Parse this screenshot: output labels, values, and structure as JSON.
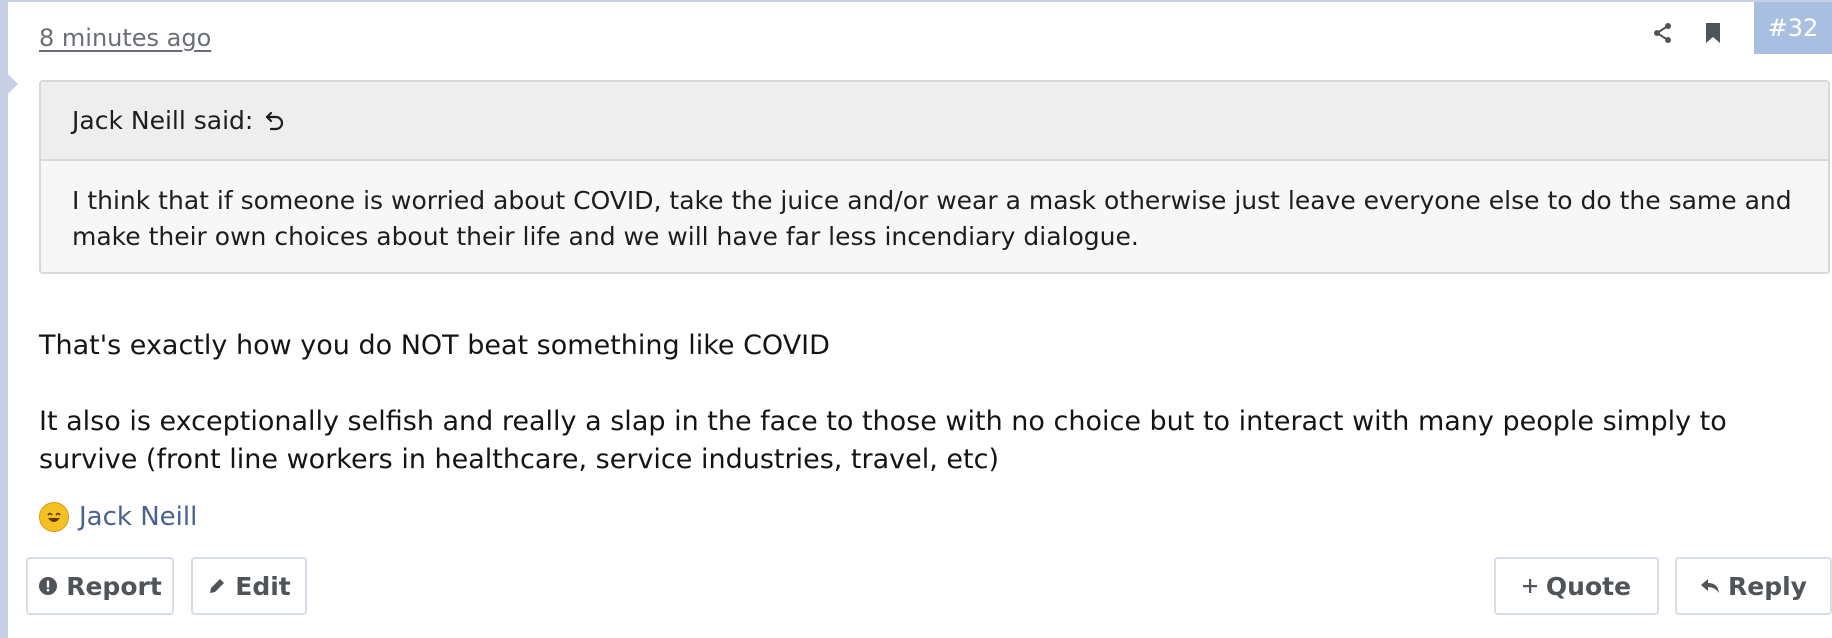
{
  "post": {
    "timestamp": "8 minutes ago",
    "number": "#32",
    "icons": {
      "share": "share-icon",
      "bookmark": "bookmark-icon"
    }
  },
  "quote": {
    "author_said": "Jack Neill said:",
    "text": "I think that if someone is worried about COVID, take the juice and/or wear a mask otherwise just leave everyone else to do the same and make their own choices about their life and we will have far less incendiary dialogue."
  },
  "message": {
    "paragraph1": "That's exactly how you do NOT beat something like COVID",
    "paragraph2": "It also is exceptionally selfish and really a slap in the face to those with no choice but to interact with many people simply to survive (front line workers in healthcare, service industries, travel, etc)"
  },
  "reactions": {
    "emoji": "laughing-emoji",
    "user": "Jack Neill"
  },
  "actions": {
    "report": "Report",
    "edit": "Edit",
    "quote": "Quote",
    "reply": "Reply"
  },
  "colors": {
    "accent": "#a9bfe2",
    "link": "#47628f",
    "border": "#c5d0e4"
  }
}
